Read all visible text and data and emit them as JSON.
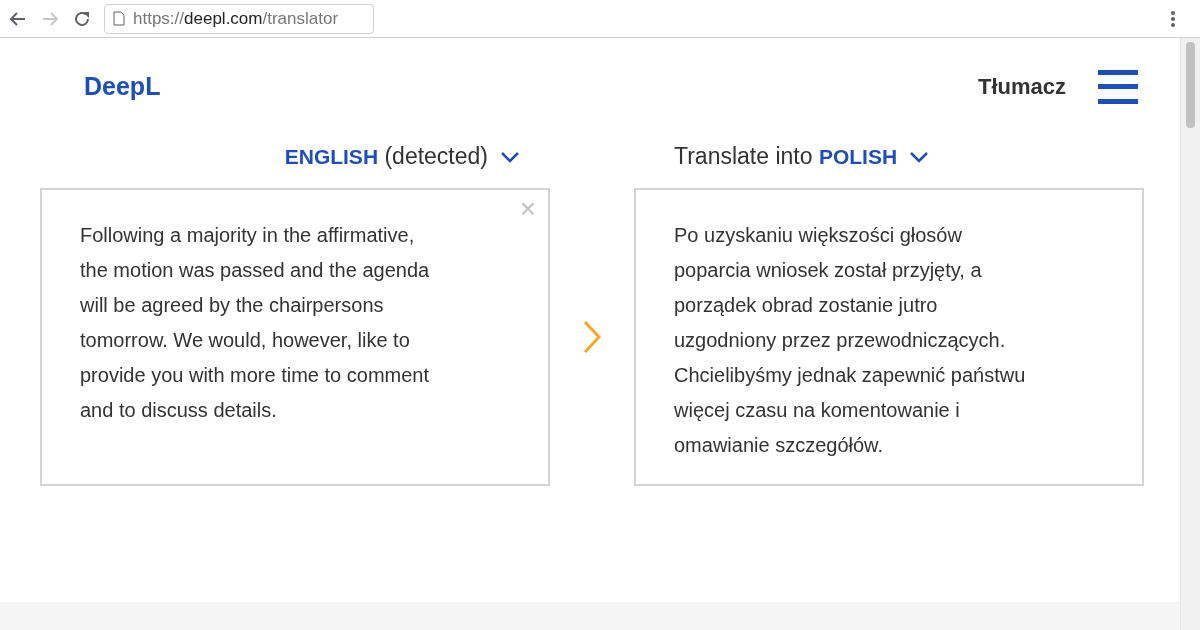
{
  "browser": {
    "url_prefix": "https://",
    "url_host": "deepl.com",
    "url_path": "/translator",
    "forward_disabled": true
  },
  "header": {
    "logo": "DeepL",
    "nav_label": "Tłumacz"
  },
  "source": {
    "language": "ENGLISH",
    "note": "(detected)",
    "lines": [
      "Following a majority in the affirmative,",
      "the motion was passed and the agenda",
      "will be agreed by the chairpersons",
      "tomorrow. We would, however, like to",
      "provide you with more time to comment",
      "and to discuss details."
    ],
    "clear_glyph": "×"
  },
  "target": {
    "prefix": "Translate into",
    "language": "POLISH",
    "lines": [
      "Po uzyskaniu większości głosów",
      "poparcia wniosek został przyjęty, a",
      "porządek obrad zostanie jutro",
      "uzgodniony przez przewodniczących.",
      "Chcielibyśmy jednak zapewnić państwu",
      "więcej czasu na komentowanie i",
      "omawianie szczegółów."
    ]
  }
}
